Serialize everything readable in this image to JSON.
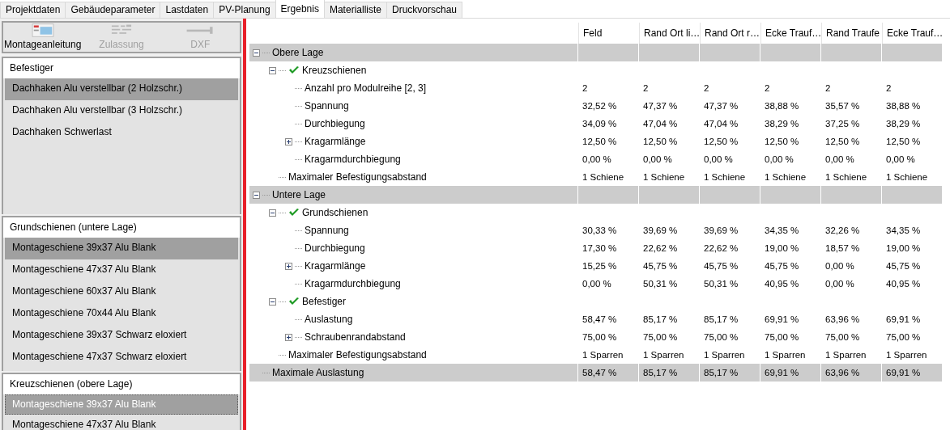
{
  "tabs": [
    {
      "label": "Projektdaten",
      "selected": false
    },
    {
      "label": "Gebäudeparameter",
      "selected": false
    },
    {
      "label": "Lastdaten",
      "selected": false
    },
    {
      "label": "PV-Planung",
      "selected": false
    },
    {
      "label": "Ergebnis",
      "selected": true
    },
    {
      "label": "Materialliste",
      "selected": false
    },
    {
      "label": "Druckvorschau",
      "selected": false
    }
  ],
  "toolbar": [
    {
      "label": "Montageanleitung",
      "kind": "manual",
      "disabled": false
    },
    {
      "label": "Zulassung",
      "kind": "approval",
      "disabled": true
    },
    {
      "label": "DXF",
      "kind": "dxf",
      "disabled": true
    }
  ],
  "lists": [
    {
      "title": "Befestiger",
      "focused": false,
      "items": [
        {
          "label": "Dachhaken Alu verstellbar (2 Holzschr.)",
          "selected": true
        },
        {
          "label": "Dachhaken Alu verstellbar (3 Holzschr.)",
          "selected": false
        },
        {
          "label": "Dachhaken Schwerlast",
          "selected": false
        }
      ]
    },
    {
      "title": "Grundschienen (untere Lage)",
      "focused": false,
      "items": [
        {
          "label": "Montageschiene 39x37 Alu Blank",
          "selected": true
        },
        {
          "label": "Montageschiene 47x37 Alu Blank",
          "selected": false
        },
        {
          "label": "Montageschiene 60x37 Alu Blank",
          "selected": false
        },
        {
          "label": "Montageschiene 70x44 Alu Blank",
          "selected": false
        },
        {
          "label": "Montageschiene 39x37 Schwarz eloxiert",
          "selected": false
        },
        {
          "label": "Montageschiene 47x37 Schwarz eloxiert",
          "selected": false
        }
      ]
    },
    {
      "title": "Kreuzschienen (obere Lage)",
      "focused": true,
      "items": [
        {
          "label": "Montageschiene 39x37 Alu Blank",
          "selected": true
        },
        {
          "label": "Montageschiene 47x37 Alu Blank",
          "selected": false
        }
      ]
    }
  ],
  "grid": {
    "columns": [
      "Feld",
      "Rand Ort li…",
      "Rand Ort r…",
      "Ecke Trauf…",
      "Rand Traufe",
      "Ecke Trauf…"
    ],
    "rows": [
      {
        "label": "Obere Lage",
        "expanded": true,
        "children": [
          {
            "label": "Kreuzschienen",
            "expanded": true,
            "ok": true,
            "children": [
              {
                "label": "Anzahl pro Modulreihe [2, 3]",
                "values": [
                  "2",
                  "2",
                  "2",
                  "2",
                  "2",
                  "2"
                ]
              },
              {
                "label": "Spannung",
                "values": [
                  "32,52 %",
                  "47,37 %",
                  "47,37 %",
                  "38,88 %",
                  "35,57 %",
                  "38,88 %"
                ]
              },
              {
                "label": "Durchbiegung",
                "values": [
                  "34,09 %",
                  "47,04 %",
                  "47,04 %",
                  "38,29 %",
                  "37,25 %",
                  "38,29 %"
                ]
              },
              {
                "label": "Kragarmlänge",
                "expanded": false,
                "values": [
                  "12,50 %",
                  "12,50 %",
                  "12,50 %",
                  "12,50 %",
                  "12,50 %",
                  "12,50 %"
                ]
              },
              {
                "label": "Kragarmdurchbiegung",
                "values": [
                  "0,00 %",
                  "0,00 %",
                  "0,00 %",
                  "0,00 %",
                  "0,00 %",
                  "0,00 %"
                ]
              }
            ]
          },
          {
            "label": "Maximaler Befestigungsabstand",
            "values": [
              "1 Schiene",
              "1 Schiene",
              "1 Schiene",
              "1 Schiene",
              "1 Schiene",
              "1 Schiene"
            ]
          }
        ]
      },
      {
        "label": "Untere Lage",
        "expanded": true,
        "children": [
          {
            "label": "Grundschienen",
            "expanded": true,
            "ok": true,
            "children": [
              {
                "label": "Spannung",
                "values": [
                  "30,33 %",
                  "39,69 %",
                  "39,69 %",
                  "34,35 %",
                  "32,26 %",
                  "34,35 %"
                ]
              },
              {
                "label": "Durchbiegung",
                "values": [
                  "17,30 %",
                  "22,62 %",
                  "22,62 %",
                  "19,00 %",
                  "18,57 %",
                  "19,00 %"
                ]
              },
              {
                "label": "Kragarmlänge",
                "expanded": false,
                "values": [
                  "15,25 %",
                  "45,75 %",
                  "45,75 %",
                  "45,75 %",
                  "0,00 %",
                  "45,75 %"
                ]
              },
              {
                "label": "Kragarmdurchbiegung",
                "values": [
                  "0,00 %",
                  "50,31 %",
                  "50,31 %",
                  "40,95 %",
                  "0,00 %",
                  "40,95 %"
                ]
              }
            ]
          },
          {
            "label": "Befestiger",
            "expanded": true,
            "ok": true,
            "children": [
              {
                "label": "Auslastung",
                "values": [
                  "58,47 %",
                  "85,17 %",
                  "85,17 %",
                  "69,91 %",
                  "63,96 %",
                  "69,91 %"
                ]
              },
              {
                "label": "Schraubenrandabstand",
                "expanded": false,
                "values": [
                  "75,00 %",
                  "75,00 %",
                  "75,00 %",
                  "75,00 %",
                  "75,00 %",
                  "75,00 %"
                ]
              }
            ]
          },
          {
            "label": "Maximaler Befestigungsabstand",
            "values": [
              "1 Sparren",
              "1 Sparren",
              "1 Sparren",
              "1 Sparren",
              "1 Sparren",
              "1 Sparren"
            ]
          }
        ]
      },
      {
        "label": "Maximale Auslastung",
        "values": [
          "58,47 %",
          "85,17 %",
          "85,17 %",
          "69,91 %",
          "63,96 %",
          "69,91 %"
        ]
      }
    ]
  }
}
